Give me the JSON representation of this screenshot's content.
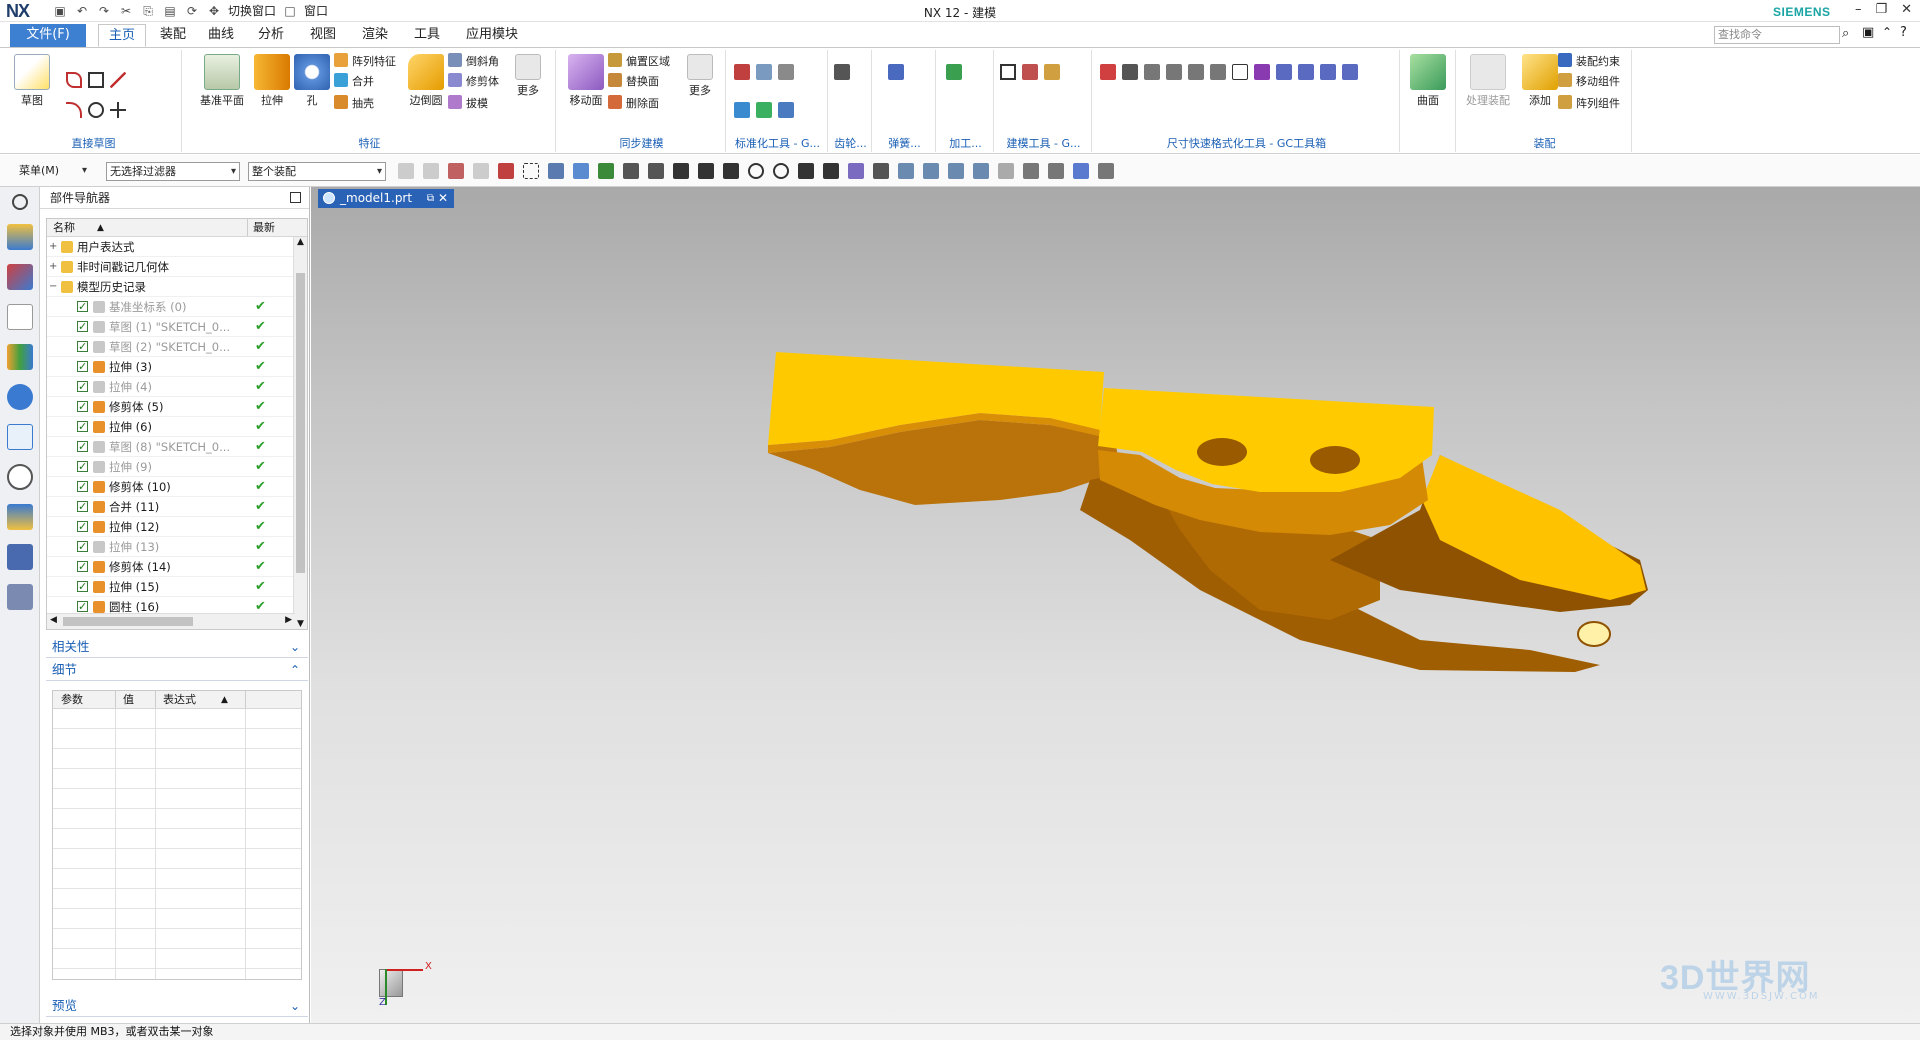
{
  "app": {
    "logo": "NX",
    "window_title": "NX 12 - 建模",
    "brand": "SIEMENS",
    "switch_window": "切换窗口",
    "window_menu": "窗口"
  },
  "tabs": [
    "文件(F)",
    "主页",
    "装配",
    "曲线",
    "分析",
    "视图",
    "渲染",
    "工具",
    "应用模块"
  ],
  "active_tab": "主页",
  "search": {
    "placeholder": "查找命令"
  },
  "ribbon": {
    "sketch_group": {
      "label": "直接草图",
      "sketch": "草图"
    },
    "feature_group": {
      "label": "特征",
      "datum_plane": "基准平面",
      "extrude": "拉伸",
      "hole": "孔",
      "pattern_feature": "阵列特征",
      "unite": "合并",
      "shell": "抽壳",
      "edge_blend": "边倒圆",
      "chamfer": "倒斜角",
      "trim_body": "修剪体",
      "draft": "拔模",
      "more": "更多"
    },
    "sync_group": {
      "label": "同步建模",
      "move_face": "移动面",
      "offset_region": "偏置区域",
      "replace_face": "替换面",
      "delete_face": "删除面",
      "more": "更多"
    },
    "std_tools": "标准化工具 - G...",
    "gear": "齿轮...",
    "spring": "弹簧...",
    "machining": "加工...",
    "modeling_tools": "建模工具 - G...",
    "dim_tools": "尺寸快速格式化工具 - GC工具箱",
    "surface": "曲面",
    "asm_group": {
      "label": "装配",
      "process": "处理装配",
      "add": "添加",
      "constraint": "装配约束",
      "move_component": "移动组件",
      "pattern_component": "阵列组件"
    }
  },
  "selection_bar": {
    "menu": "菜单(M)",
    "filter": "无选择过滤器",
    "scope": "整个装配"
  },
  "navigator": {
    "title": "部件导航器",
    "col_name": "名称",
    "col_latest": "最新",
    "rows": [
      {
        "label": "用户表达式",
        "dim": false,
        "level": 0
      },
      {
        "label": "非时间戳记几何体",
        "dim": false,
        "level": 0
      },
      {
        "label": "模型历史记录",
        "dim": false,
        "level": 0
      },
      {
        "label": "基准坐标系 (0)",
        "dim": true,
        "level": 1
      },
      {
        "label": "草图 (1) \"SKETCH_0...",
        "dim": true,
        "level": 1
      },
      {
        "label": "草图 (2) \"SKETCH_0...",
        "dim": true,
        "level": 1
      },
      {
        "label": "拉伸 (3)",
        "dim": false,
        "level": 1
      },
      {
        "label": "拉伸 (4)",
        "dim": true,
        "level": 1
      },
      {
        "label": "修剪体 (5)",
        "dim": false,
        "level": 1
      },
      {
        "label": "拉伸 (6)",
        "dim": false,
        "level": 1
      },
      {
        "label": "草图 (8) \"SKETCH_0...",
        "dim": true,
        "level": 1
      },
      {
        "label": "拉伸 (9)",
        "dim": true,
        "level": 1
      },
      {
        "label": "修剪体 (10)",
        "dim": false,
        "level": 1
      },
      {
        "label": "合并 (11)",
        "dim": false,
        "level": 1
      },
      {
        "label": "拉伸 (12)",
        "dim": false,
        "level": 1
      },
      {
        "label": "拉伸 (13)",
        "dim": true,
        "level": 1
      },
      {
        "label": "修剪体 (14)",
        "dim": false,
        "level": 1
      },
      {
        "label": "拉伸 (15)",
        "dim": false,
        "level": 1
      },
      {
        "label": "圆柱 (16)",
        "dim": false,
        "level": 1
      }
    ],
    "relations": "相关性",
    "details": "细节",
    "detail_cols": [
      "参数",
      "值",
      "表达式"
    ],
    "preview": "预览"
  },
  "doc_tab": "_model1.prt",
  "triad": {
    "x": "X",
    "z": "Z"
  },
  "status": "选择对象并使用 MB3，或者双击某一对象",
  "watermark": {
    "main": "3D世界网",
    "sub": "WWW.3DSJW.COM"
  },
  "colors": {
    "accent": "#3d7fd1",
    "part": "#f5b800",
    "part_shade": "#b06d00"
  }
}
